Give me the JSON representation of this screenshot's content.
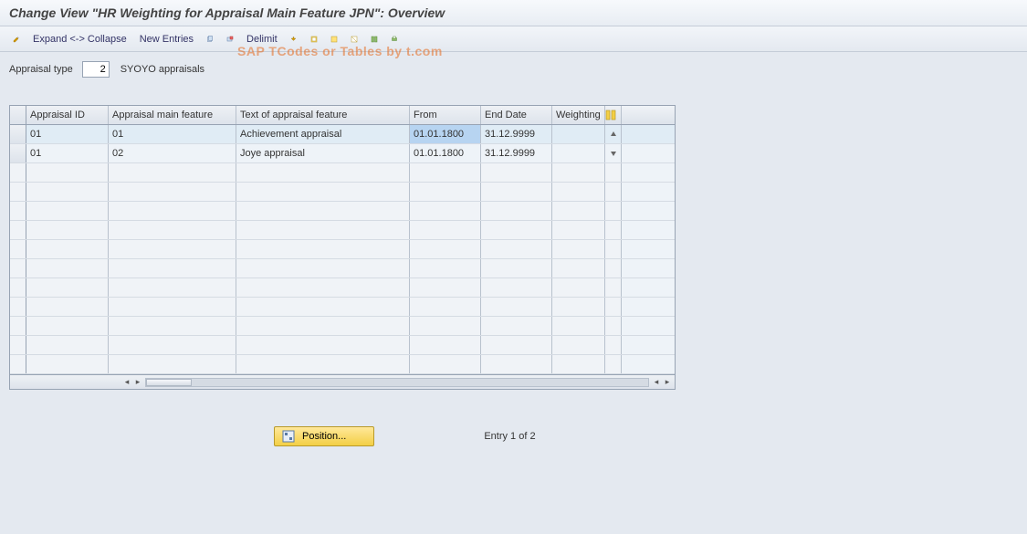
{
  "title": "Change View \"HR Weighting for Appraisal Main Feature JPN\": Overview",
  "toolbar": {
    "expand_collapse": "Expand <-> Collapse",
    "new_entries": "New Entries",
    "delimit": "Delimit"
  },
  "filter": {
    "label": "Appraisal type",
    "value": "2",
    "description": "SYOYO  appraisals"
  },
  "table": {
    "columns": {
      "appraisal_id": "Appraisal ID",
      "main_feature": "Appraisal main feature",
      "text": "Text of appraisal feature",
      "from": "From",
      "end": "End Date",
      "weighting": "Weighting"
    },
    "rows": [
      {
        "id": "01",
        "main": "01",
        "text": "Achievement appraisal",
        "from": "01.01.1800",
        "end": "31.12.9999",
        "weight": ""
      },
      {
        "id": "01",
        "main": "02",
        "text": "Joye appraisal",
        "from": "01.01.1800",
        "end": "31.12.9999",
        "weight": ""
      }
    ]
  },
  "footer": {
    "position_btn": "Position...",
    "entry_text": "Entry 1 of 2"
  },
  "watermark": "SAP TCodes or Tables by t.com"
}
